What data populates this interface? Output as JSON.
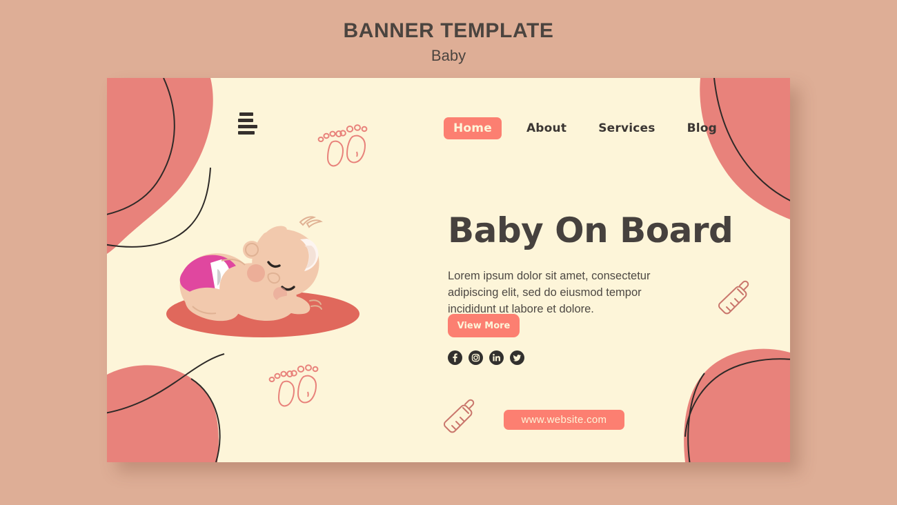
{
  "page": {
    "title": "BANNER TEMPLATE",
    "subtitle": "Baby",
    "background_color": "#deae96",
    "title_color": "#4b443f"
  },
  "banner": {
    "background_color": "#fdf5d9",
    "blob_color": "#e8827b",
    "accent_color": "#fc7f71",
    "line_color": "#2e2a28",
    "nav": {
      "menu_icon": "hamburger-menu-icon",
      "items": [
        {
          "label": "Home",
          "active": true
        },
        {
          "label": "About",
          "active": false
        },
        {
          "label": "Services",
          "active": false
        },
        {
          "label": "Blog",
          "active": false
        }
      ]
    },
    "hero": {
      "headline": "Baby On Board",
      "body": "Lorem ipsum dolor sit amet, consectetur adipiscing elit, sed do eiusmod tempor incididunt ut labore et dolore.",
      "cta_label": "View More",
      "website_label": "www.website.com"
    },
    "socials": [
      {
        "name": "facebook-icon"
      },
      {
        "name": "instagram-icon"
      },
      {
        "name": "linkedin-icon"
      },
      {
        "name": "twitter-icon"
      }
    ],
    "decorations": [
      {
        "name": "baby-footprints-icon",
        "position": "top-left"
      },
      {
        "name": "baby-footprints-icon",
        "position": "bottom-left"
      },
      {
        "name": "baby-bottle-icon",
        "position": "right"
      },
      {
        "name": "baby-bottle-icon",
        "position": "bottom-center"
      }
    ],
    "illustration": {
      "name": "sleeping-baby-illustration",
      "skin_color": "#f2c9ad",
      "diaper_color": "#e0479f",
      "mat_color": "#e0685c"
    }
  }
}
